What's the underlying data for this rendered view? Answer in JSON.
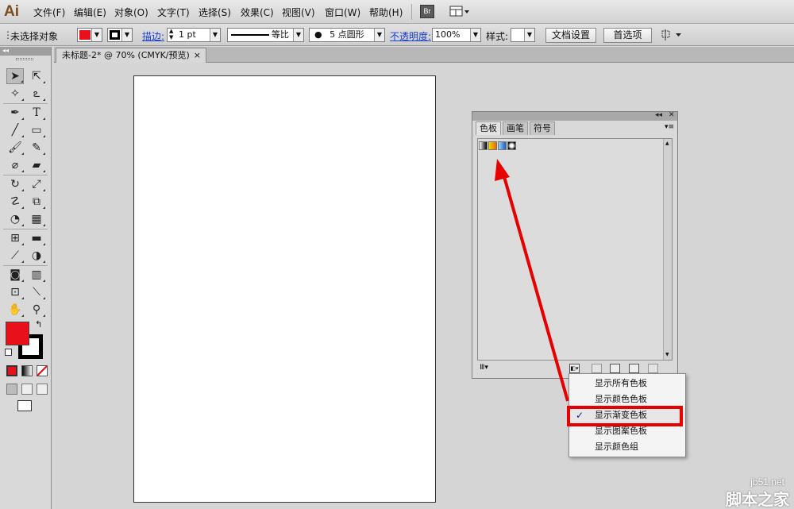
{
  "app": {
    "logo": "Ai"
  },
  "menubar": {
    "items": [
      "文件(F)",
      "编辑(E)",
      "对象(O)",
      "文字(T)",
      "选择(S)",
      "效果(C)",
      "视图(V)",
      "窗口(W)",
      "帮助(H)"
    ],
    "bridge_label": "Br"
  },
  "controlbar": {
    "selection_status": "未选择对象",
    "stroke_label": "描边:",
    "stroke_weight": "1 pt",
    "stroke_profile": "等比",
    "brush_label": "5 点圆形",
    "opacity_label": "不透明度:",
    "opacity_value": "100%",
    "style_label": "样式:",
    "doc_setup_button": "文档设置",
    "preferences_button": "首选项",
    "fill_color": "#e8101b"
  },
  "document": {
    "tab_title": "未标题-2* @ 70% (CMYK/预览)",
    "tab_close": "×"
  },
  "tools": {
    "fill_color": "#e8101b",
    "stroke_color": "#000000"
  },
  "swatches_panel": {
    "tabs": [
      "色板",
      "画笔",
      "符号"
    ],
    "active_tab": "色板"
  },
  "context_menu": {
    "items": [
      "显示所有色板",
      "显示颜色色板",
      "显示渐变色板",
      "显示图案色板",
      "显示颜色组"
    ],
    "checked_item": "显示渐变色板",
    "check_mark": "✓"
  },
  "watermark": {
    "site": "jb51.net",
    "brand": "脚本之家"
  },
  "annotation": {
    "arrow_color": "#e60000",
    "highlight_color": "#e60000"
  }
}
